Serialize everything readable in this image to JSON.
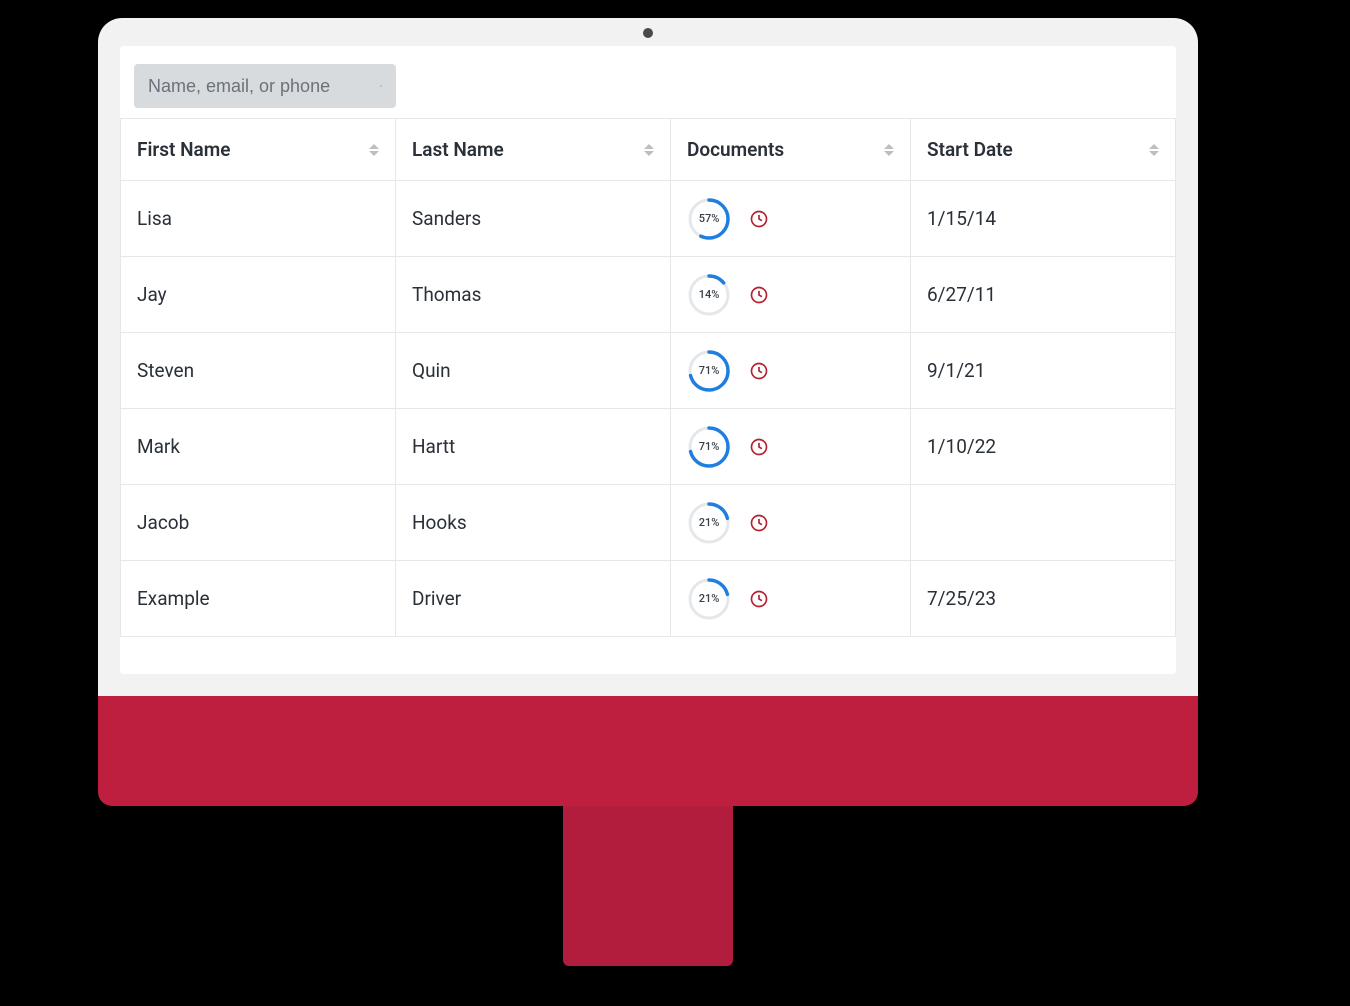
{
  "search": {
    "placeholder": "Name, email, or phone",
    "value": ""
  },
  "table": {
    "columns": {
      "first_name": "First Name",
      "last_name": "Last Name",
      "documents": "Documents",
      "start_date": "Start Date"
    },
    "rows": [
      {
        "first_name": "Lisa",
        "last_name": "Sanders",
        "doc_pct": 57,
        "doc_pct_label": "57%",
        "has_pending": true,
        "start_date": "1/15/14"
      },
      {
        "first_name": "Jay",
        "last_name": "Thomas",
        "doc_pct": 14,
        "doc_pct_label": "14%",
        "has_pending": true,
        "start_date": "6/27/11"
      },
      {
        "first_name": "Steven",
        "last_name": "Quin",
        "doc_pct": 71,
        "doc_pct_label": "71%",
        "has_pending": true,
        "start_date": "9/1/21"
      },
      {
        "first_name": "Mark",
        "last_name": "Hartt",
        "doc_pct": 71,
        "doc_pct_label": "71%",
        "has_pending": true,
        "start_date": "1/10/22"
      },
      {
        "first_name": "Jacob",
        "last_name": "Hooks",
        "doc_pct": 21,
        "doc_pct_label": "21%",
        "has_pending": true,
        "start_date": ""
      },
      {
        "first_name": "Example",
        "last_name": "Driver",
        "doc_pct": 21,
        "doc_pct_label": "21%",
        "has_pending": true,
        "start_date": "7/25/23"
      }
    ]
  }
}
